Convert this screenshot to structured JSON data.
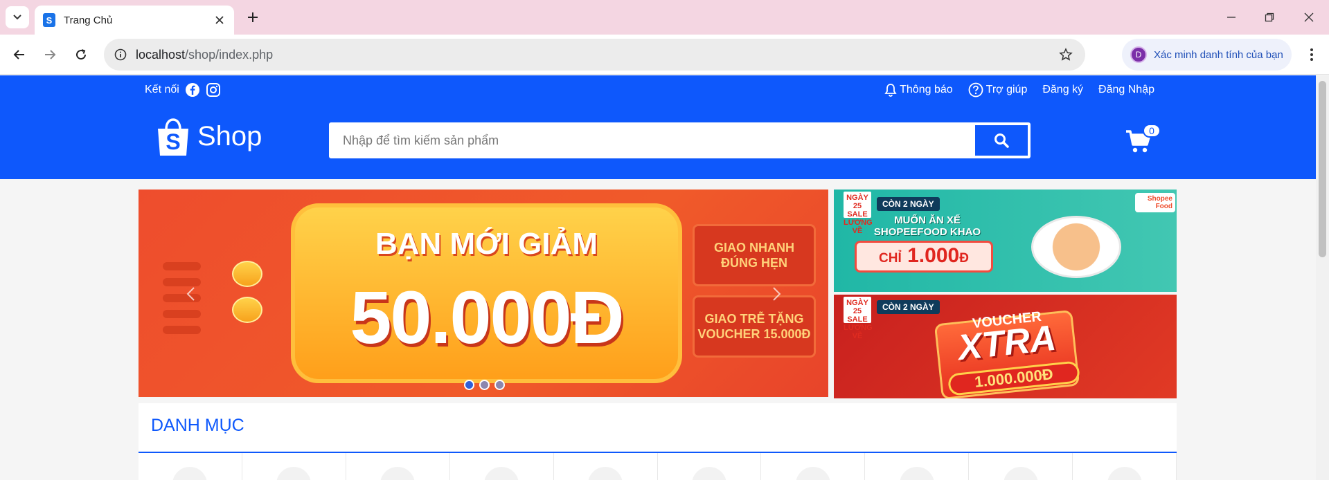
{
  "browser": {
    "tab_title": "Trang Chủ",
    "favicon_letter": "S",
    "url_host": "localhost",
    "url_path": "/shop/index.php",
    "profile_initial": "D",
    "profile_text": "Xác minh danh tính của bạn"
  },
  "header": {
    "connect_label": "Kết nối",
    "links": {
      "notifications": "Thông báo",
      "help": "Trợ giúp",
      "register": "Đăng ký",
      "login": "Đăng Nhập"
    },
    "logo_text": "Shop",
    "logo_letter": "S",
    "search_placeholder": "Nhập để tìm kiếm sản phẩm",
    "cart_count": "0"
  },
  "banner_main": {
    "title": "BẠN MỚI GIẢM",
    "amount": "50.000Đ",
    "box1": "GIAO NHANH ĐÚNG HẸN",
    "box2": "GIAO TRỄ TẶNG VOUCHER 15.000Đ",
    "active_slide": 1,
    "slide_count": 3
  },
  "banner_food": {
    "sale_tag": "NGÀY 25 SALE LƯƠNG VỀ",
    "days_left": "CÒN 2 NGÀY",
    "headline": "MUỐN ĂN XẾ SHOPEEFOOD KHAO",
    "price_prefix": "CHỈ",
    "price": "1.000",
    "price_unit": "Đ",
    "brand": "Shopee Food"
  },
  "banner_voucher": {
    "sale_tag": "NGÀY 25 SALE LƯƠNG VỀ",
    "days_left": "CÒN 2 NGÀY",
    "voucher_word": "VOUCHER",
    "xtra_word": "XTRA",
    "price": "1.000.000Đ"
  },
  "category": {
    "title": "DANH MỤC",
    "item_count": 10
  },
  "colors": {
    "brand_blue": "#0e58fc",
    "banner_orange": "#ee4d2d"
  }
}
